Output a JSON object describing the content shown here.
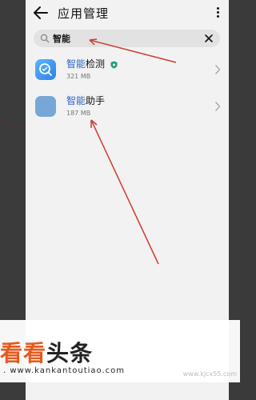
{
  "appbar": {
    "title": "应用管理"
  },
  "search": {
    "query": "智能"
  },
  "apps": [
    {
      "highlight": "智能",
      "rest": "检测",
      "size": "321 MB",
      "icon": "app-detect-icon",
      "badge": "shield-check-icon"
    },
    {
      "highlight": "智能",
      "rest": "助手",
      "size": "187 MB",
      "icon": "app-assistant-icon"
    }
  ],
  "watermark": {
    "brand_orange": "看看",
    "brand_dark": "头条",
    "url": ". www.kankantoutiao.com",
    "corner": "www.kjcx55.com"
  },
  "colors": {
    "highlight": "#2a64c8",
    "annotation": "#d23a2a",
    "brand": "#e55a1c"
  }
}
